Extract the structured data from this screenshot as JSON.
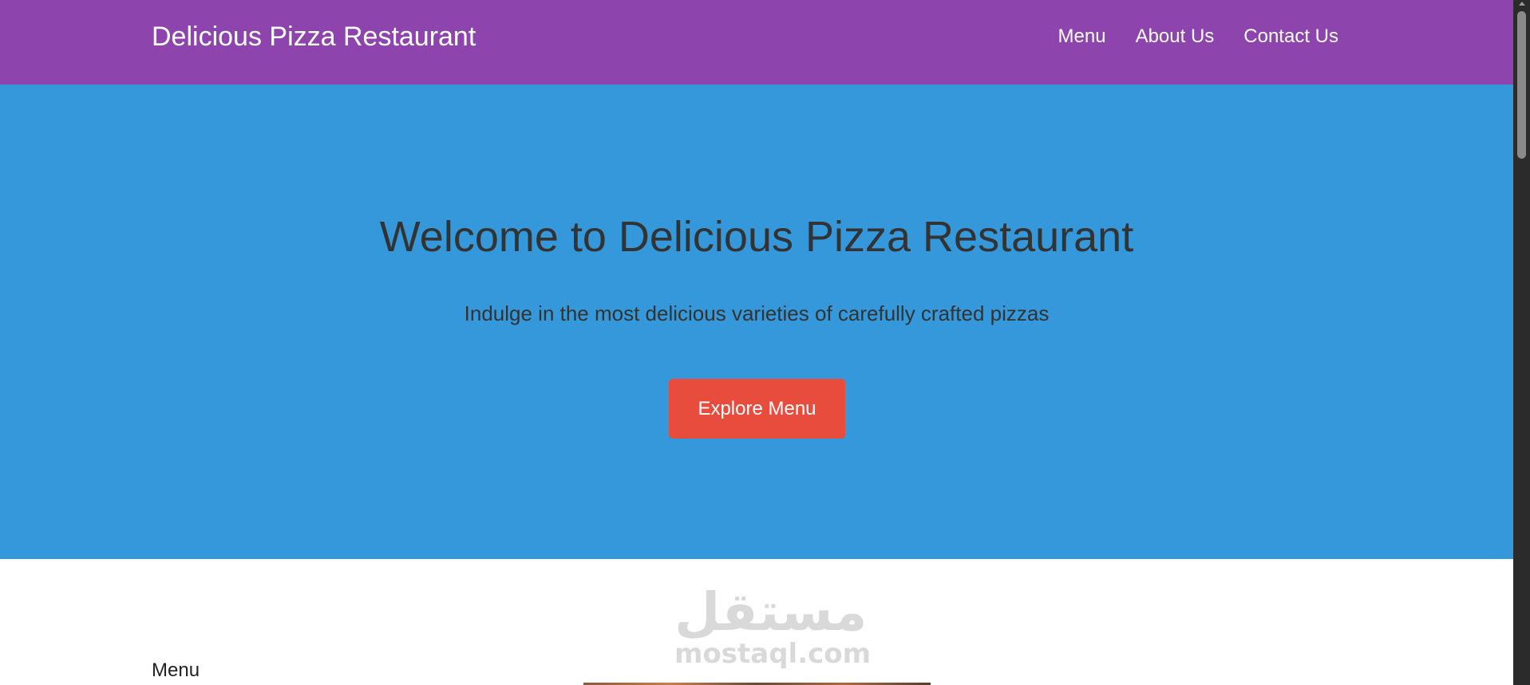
{
  "header": {
    "brand": "Delicious Pizza Restaurant",
    "nav": [
      {
        "label": "Menu"
      },
      {
        "label": "About Us"
      },
      {
        "label": "Contact Us"
      }
    ]
  },
  "hero": {
    "title": "Welcome to Delicious Pizza Restaurant",
    "subtitle": "Indulge in the most delicious varieties of carefully crafted pizzas",
    "button_label": "Explore Menu"
  },
  "menu_section": {
    "heading": "Menu"
  },
  "watermark": {
    "arabic": "مستقل",
    "latin": "mostaql.com"
  },
  "colors": {
    "header_bg": "#8e44ad",
    "hero_bg": "#3498db",
    "button_bg": "#e74c3c",
    "text_dark": "#333333"
  },
  "icons": {
    "scroll_up": "scroll-up-arrow-icon"
  }
}
